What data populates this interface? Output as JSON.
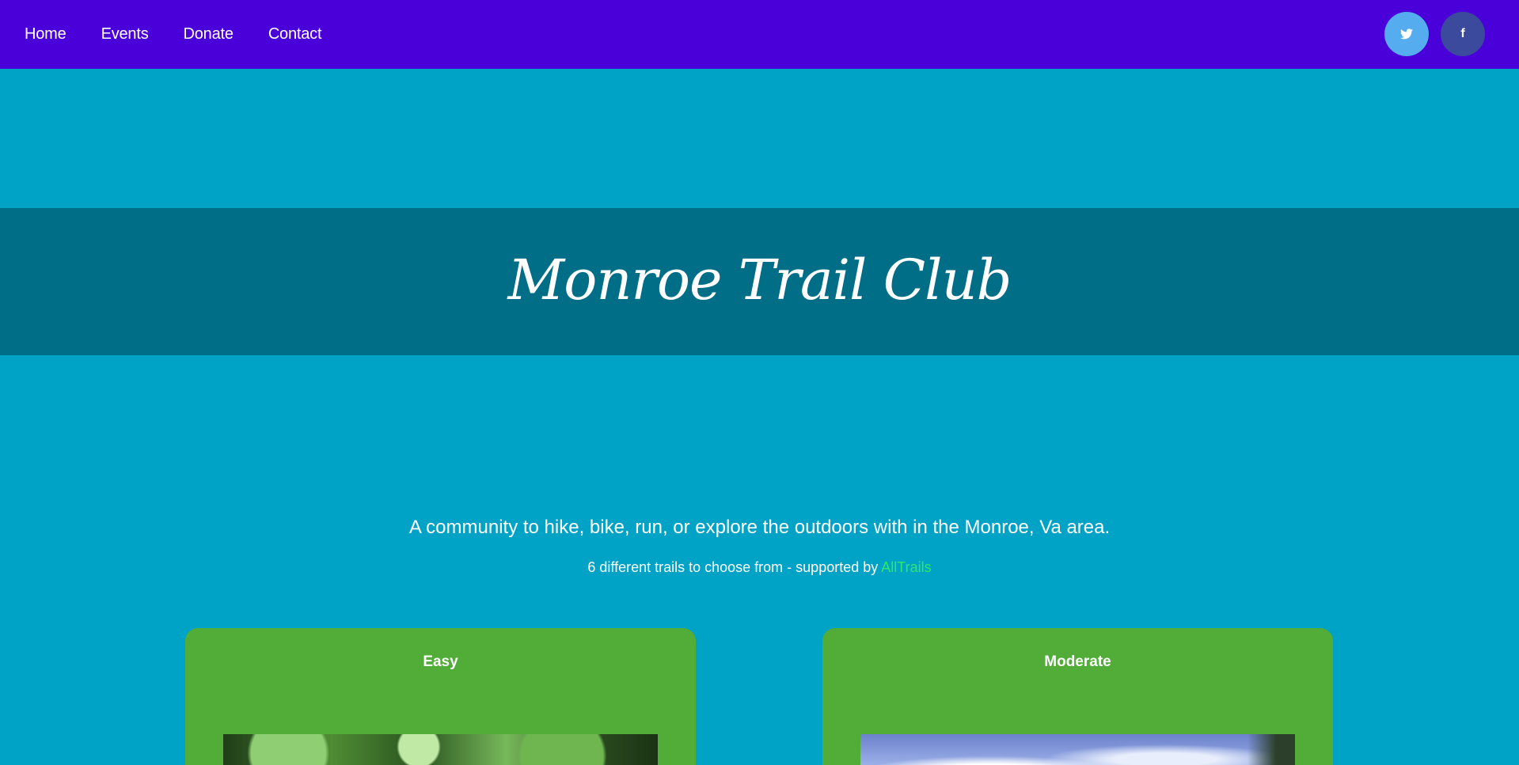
{
  "nav": {
    "links": [
      "Home",
      "Events",
      "Donate",
      "Contact"
    ],
    "social": [
      {
        "name": "twitter",
        "glyph": "🐦",
        "color": "#55acee"
      },
      {
        "name": "facebook",
        "glyph": "f",
        "color": "#3b4a9c"
      }
    ]
  },
  "hero": {
    "title": "Monroe Trail Club"
  },
  "intro": {
    "tagline": "A community to hike, bike, run, or explore the outdoors with in the Monroe, Va area.",
    "subline_prefix": "6 different trails to choose from - supported by ",
    "subline_link": "AllTrails"
  },
  "cards": [
    {
      "title": "Easy",
      "photo": "forest-photo"
    },
    {
      "title": "Moderate",
      "photo": "sky-photo"
    }
  ],
  "colors": {
    "nav_bg": "#4a00d8",
    "page_bg": "#00a2c6",
    "hero_band": "#006e86",
    "card_bg": "#52ad38",
    "link": "#2fe86a"
  }
}
